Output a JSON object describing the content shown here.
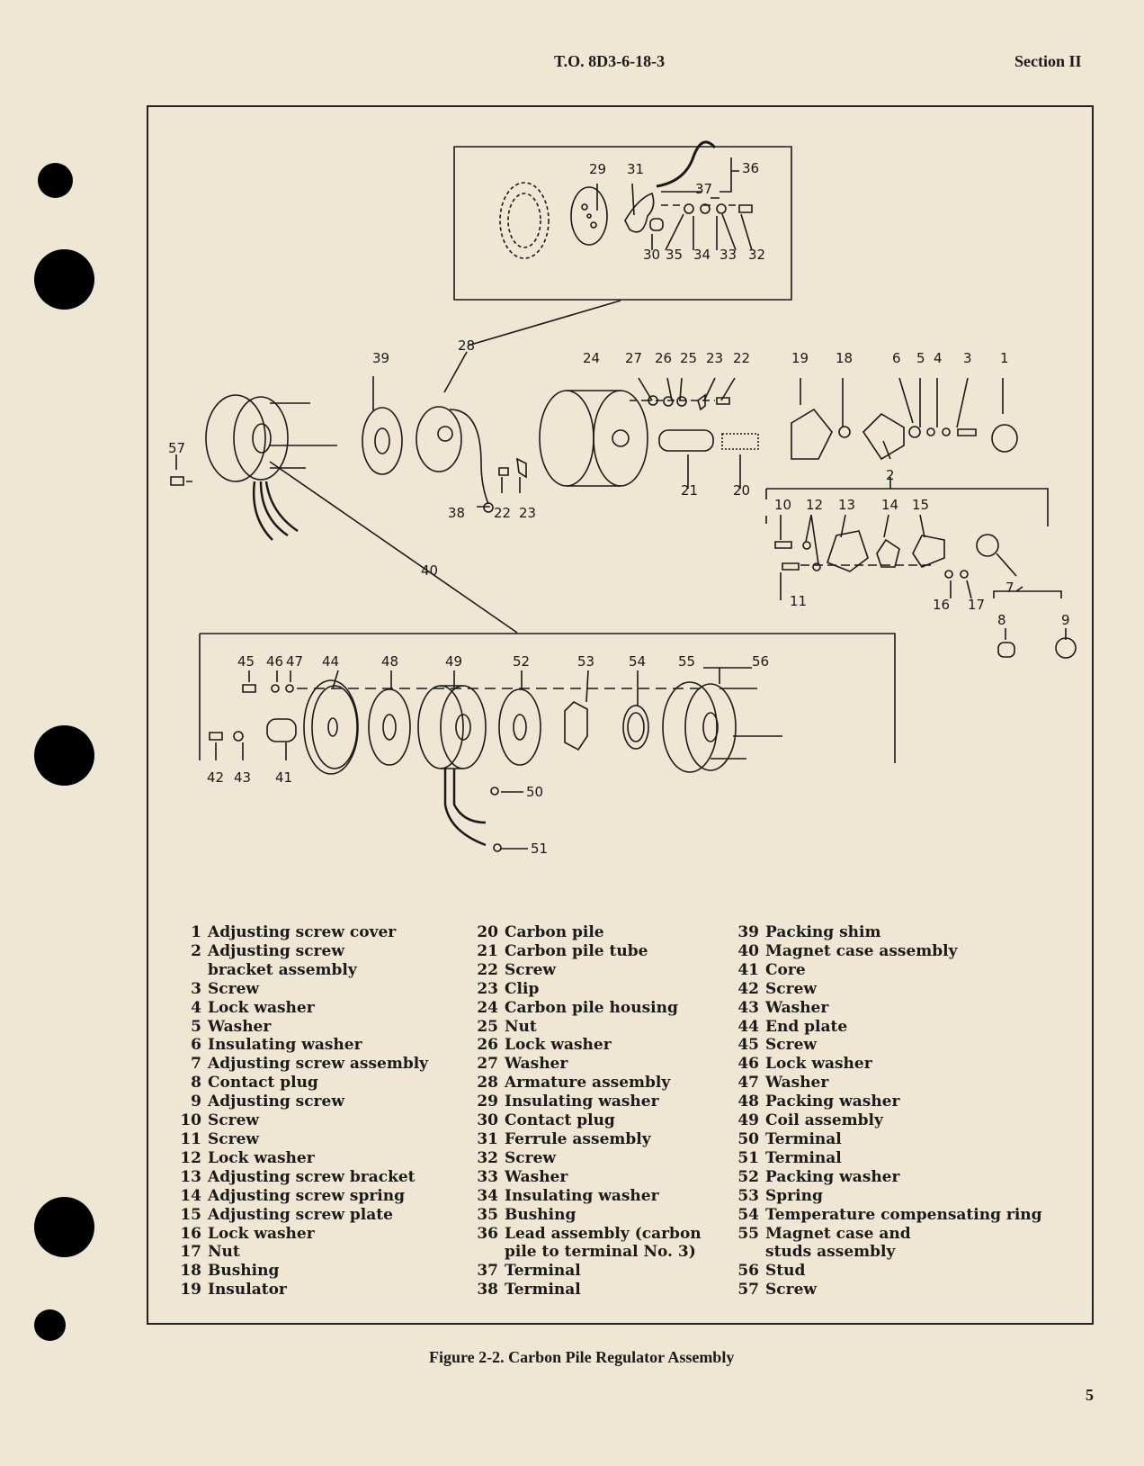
{
  "header": {
    "doc_number": "T.O. 8D3-6-18-3",
    "section": "Section II"
  },
  "figure": {
    "caption": "Figure 2-2.  Carbon Pile Regulator Assembly",
    "callouts": [
      "1",
      "2",
      "3",
      "4",
      "5",
      "6",
      "7",
      "8",
      "9",
      "10",
      "11",
      "12",
      "13",
      "14",
      "15",
      "16",
      "17",
      "18",
      "19",
      "20",
      "21",
      "22",
      "23",
      "24",
      "25",
      "26",
      "27",
      "28",
      "29",
      "30",
      "31",
      "32",
      "33",
      "34",
      "35",
      "36",
      "37",
      "38",
      "39",
      "40",
      "41",
      "42",
      "43",
      "44",
      "45",
      "46",
      "47",
      "48",
      "49",
      "50",
      "51",
      "52",
      "53",
      "54",
      "55",
      "56",
      "57"
    ]
  },
  "legend": {
    "columns": [
      [
        {
          "num": "1",
          "text": "Adjusting screw cover"
        },
        {
          "num": "2",
          "text": "Adjusting screw\nbracket assembly"
        },
        {
          "num": "3",
          "text": "Screw"
        },
        {
          "num": "4",
          "text": "Lock washer"
        },
        {
          "num": "5",
          "text": "Washer"
        },
        {
          "num": "6",
          "text": "Insulating washer"
        },
        {
          "num": "7",
          "text": "Adjusting screw assembly"
        },
        {
          "num": "8",
          "text": "Contact plug"
        },
        {
          "num": "9",
          "text": "Adjusting screw"
        },
        {
          "num": "10",
          "text": "Screw"
        },
        {
          "num": "11",
          "text": "Screw"
        },
        {
          "num": "12",
          "text": "Lock washer"
        },
        {
          "num": "13",
          "text": "Adjusting screw bracket"
        },
        {
          "num": "14",
          "text": "Adjusting screw spring"
        },
        {
          "num": "15",
          "text": "Adjusting screw plate"
        },
        {
          "num": "16",
          "text": "Lock washer"
        },
        {
          "num": "17",
          "text": "Nut"
        },
        {
          "num": "18",
          "text": "Bushing"
        },
        {
          "num": "19",
          "text": "Insulator"
        }
      ],
      [
        {
          "num": "20",
          "text": "Carbon pile"
        },
        {
          "num": "21",
          "text": "Carbon pile tube"
        },
        {
          "num": "22",
          "text": "Screw"
        },
        {
          "num": "23",
          "text": "Clip"
        },
        {
          "num": "24",
          "text": "Carbon pile housing"
        },
        {
          "num": "25",
          "text": "Nut"
        },
        {
          "num": "26",
          "text": "Lock washer"
        },
        {
          "num": "27",
          "text": "Washer"
        },
        {
          "num": "28",
          "text": "Armature assembly"
        },
        {
          "num": "29",
          "text": "Insulating washer"
        },
        {
          "num": "30",
          "text": "Contact plug"
        },
        {
          "num": "31",
          "text": "Ferrule assembly"
        },
        {
          "num": "32",
          "text": "Screw"
        },
        {
          "num": "33",
          "text": "Washer"
        },
        {
          "num": "34",
          "text": "Insulating washer"
        },
        {
          "num": "35",
          "text": "Bushing"
        },
        {
          "num": "36",
          "text": "Lead assembly (carbon\npile to terminal No. 3)"
        },
        {
          "num": "37",
          "text": "Terminal"
        },
        {
          "num": "38",
          "text": "Terminal"
        }
      ],
      [
        {
          "num": "39",
          "text": "Packing shim"
        },
        {
          "num": "40",
          "text": "Magnet case assembly"
        },
        {
          "num": "41",
          "text": "Core"
        },
        {
          "num": "42",
          "text": "Screw"
        },
        {
          "num": "43",
          "text": "Washer"
        },
        {
          "num": "44",
          "text": "End plate"
        },
        {
          "num": "45",
          "text": "Screw"
        },
        {
          "num": "46",
          "text": "Lock washer"
        },
        {
          "num": "47",
          "text": "Washer"
        },
        {
          "num": "48",
          "text": "Packing washer"
        },
        {
          "num": "49",
          "text": "Coil assembly"
        },
        {
          "num": "50",
          "text": "Terminal"
        },
        {
          "num": "51",
          "text": "Terminal"
        },
        {
          "num": "52",
          "text": "Packing washer"
        },
        {
          "num": "53",
          "text": "Spring"
        },
        {
          "num": "54",
          "text": "Temperature compensating ring"
        },
        {
          "num": "55",
          "text": "Magnet case and\nstuds assembly"
        },
        {
          "num": "56",
          "text": "Stud"
        },
        {
          "num": "57",
          "text": "Screw"
        }
      ]
    ]
  },
  "page_number": "5"
}
